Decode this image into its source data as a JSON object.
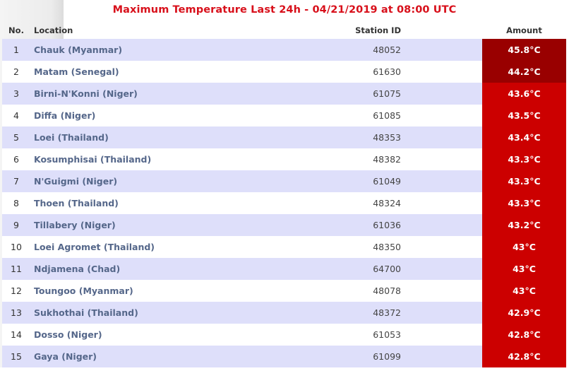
{
  "title": "Maximum Temperature Last 24h - 04/21/2019 at 08:00 UTC",
  "columns": {
    "no": "No.",
    "location": "Location",
    "station_id": "Station ID",
    "amount": "Amount"
  },
  "colors": {
    "title": "#d8101b",
    "row_alt": "#dedffa",
    "amount_extreme": "#990000",
    "amount_high": "#cc0000"
  },
  "rows": [
    {
      "no": "1",
      "location": "Chauk (Myanmar)",
      "station_id": "48052",
      "amount": "45.8°C",
      "level": "extreme"
    },
    {
      "no": "2",
      "location": "Matam (Senegal)",
      "station_id": "61630",
      "amount": "44.2°C",
      "level": "extreme"
    },
    {
      "no": "3",
      "location": "Birni-N'Konni (Niger)",
      "station_id": "61075",
      "amount": "43.6°C",
      "level": "high"
    },
    {
      "no": "4",
      "location": "Diffa (Niger)",
      "station_id": "61085",
      "amount": "43.5°C",
      "level": "high"
    },
    {
      "no": "5",
      "location": "Loei (Thailand)",
      "station_id": "48353",
      "amount": "43.4°C",
      "level": "high"
    },
    {
      "no": "6",
      "location": "Kosumphisai (Thailand)",
      "station_id": "48382",
      "amount": "43.3°C",
      "level": "high"
    },
    {
      "no": "7",
      "location": "N'Guigmi (Niger)",
      "station_id": "61049",
      "amount": "43.3°C",
      "level": "high"
    },
    {
      "no": "8",
      "location": "Thoen (Thailand)",
      "station_id": "48324",
      "amount": "43.3°C",
      "level": "high"
    },
    {
      "no": "9",
      "location": "Tillabery (Niger)",
      "station_id": "61036",
      "amount": "43.2°C",
      "level": "high"
    },
    {
      "no": "10",
      "location": "Loei Agromet (Thailand)",
      "station_id": "48350",
      "amount": "43°C",
      "level": "high"
    },
    {
      "no": "11",
      "location": "Ndjamena (Chad)",
      "station_id": "64700",
      "amount": "43°C",
      "level": "high"
    },
    {
      "no": "12",
      "location": "Toungoo (Myanmar)",
      "station_id": "48078",
      "amount": "43°C",
      "level": "high"
    },
    {
      "no": "13",
      "location": "Sukhothai (Thailand)",
      "station_id": "48372",
      "amount": "42.9°C",
      "level": "high"
    },
    {
      "no": "14",
      "location": "Dosso (Niger)",
      "station_id": "61053",
      "amount": "42.8°C",
      "level": "high"
    },
    {
      "no": "15",
      "location": "Gaya (Niger)",
      "station_id": "61099",
      "amount": "42.8°C",
      "level": "high"
    }
  ]
}
